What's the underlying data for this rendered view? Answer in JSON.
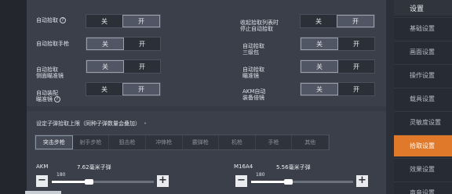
{
  "pickup_settings": {
    "left": [
      {
        "label": "自动拾取",
        "has_help": true,
        "off": "关",
        "on": "开",
        "state": "on"
      },
      {
        "label": "自动拾取手枪",
        "has_help": false,
        "off": "关",
        "on": "开",
        "state": "off"
      },
      {
        "label": "自动拾取\n侧面瞄准镜",
        "has_help": false,
        "off": "关",
        "on": "开",
        "state": "off"
      },
      {
        "label": "自动装配\n瞄准镜",
        "has_help": true,
        "off": "关",
        "on": "开",
        "state": "on"
      }
    ],
    "right": [
      {
        "label": "收起拾取列表时\n停止自动拾取",
        "off": "关",
        "on": "开",
        "state": "on"
      },
      {
        "label": "自动拾取\n三级包",
        "off": "关",
        "on": "开",
        "state": "off"
      },
      {
        "label": "自动拾取\n瞄准镜",
        "off": "关",
        "on": "开",
        "state": "off"
      },
      {
        "label": "AKM自动\n装备倍镜",
        "off": "关",
        "on": "开",
        "state": "off"
      }
    ]
  },
  "ammo": {
    "title": "设定子弹拾取上限（同种子弹数量会叠加）",
    "title_dot": "•",
    "tabs": [
      "突击步枪",
      "射手步枪",
      "狙击枪",
      "冲锋枪",
      "霰弹枪",
      "机枪",
      "手枪",
      "其他"
    ],
    "active_tab": 0,
    "guns": [
      {
        "name": "AKM",
        "ammo": "7.62毫米子弹",
        "value": "180",
        "level": 0.36
      },
      {
        "name": "M16A4",
        "ammo": "5.56毫米子弹",
        "value": "180",
        "level": 0.36
      }
    ],
    "minus": "−",
    "plus": "+"
  },
  "sidebar": {
    "title": "设置",
    "items": [
      "基础设置",
      "画面设置",
      "操作设置",
      "载具设置",
      "灵敏度设置",
      "拾取设置",
      "效果设置",
      "声音设置"
    ],
    "active": 5
  },
  "colors": {
    "accent": "#e07a2a",
    "panel": "#3a3f4a",
    "toggle_on": "#505664"
  }
}
